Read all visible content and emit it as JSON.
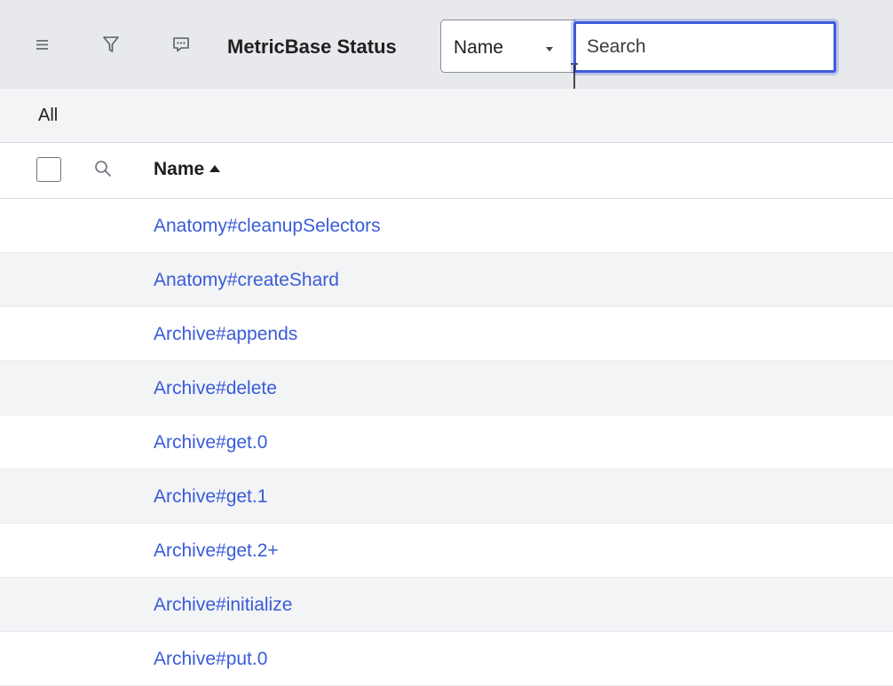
{
  "header": {
    "title": "MetricBase Status",
    "menu_icon": "hamburger-icon",
    "filter_icon": "funnel-icon",
    "comment_icon": "chat-bubble-icon",
    "search_field_select": "Name",
    "search_placeholder": "Search"
  },
  "filter": {
    "breadcrumb": "All"
  },
  "table": {
    "column_header": "Name",
    "sort": "ascending",
    "rows": [
      "Anatomy#cleanupSelectors",
      "Anatomy#createShard",
      "Archive#appends",
      "Archive#delete",
      "Archive#get.0",
      "Archive#get.1",
      "Archive#get.2+",
      "Archive#initialize",
      "Archive#put.0"
    ]
  },
  "colors": {
    "link": "#3a5bd8",
    "focus": "#3f5bd9",
    "header_bg": "#e7e9ec",
    "alt_row_bg": "#f3f4f6"
  }
}
